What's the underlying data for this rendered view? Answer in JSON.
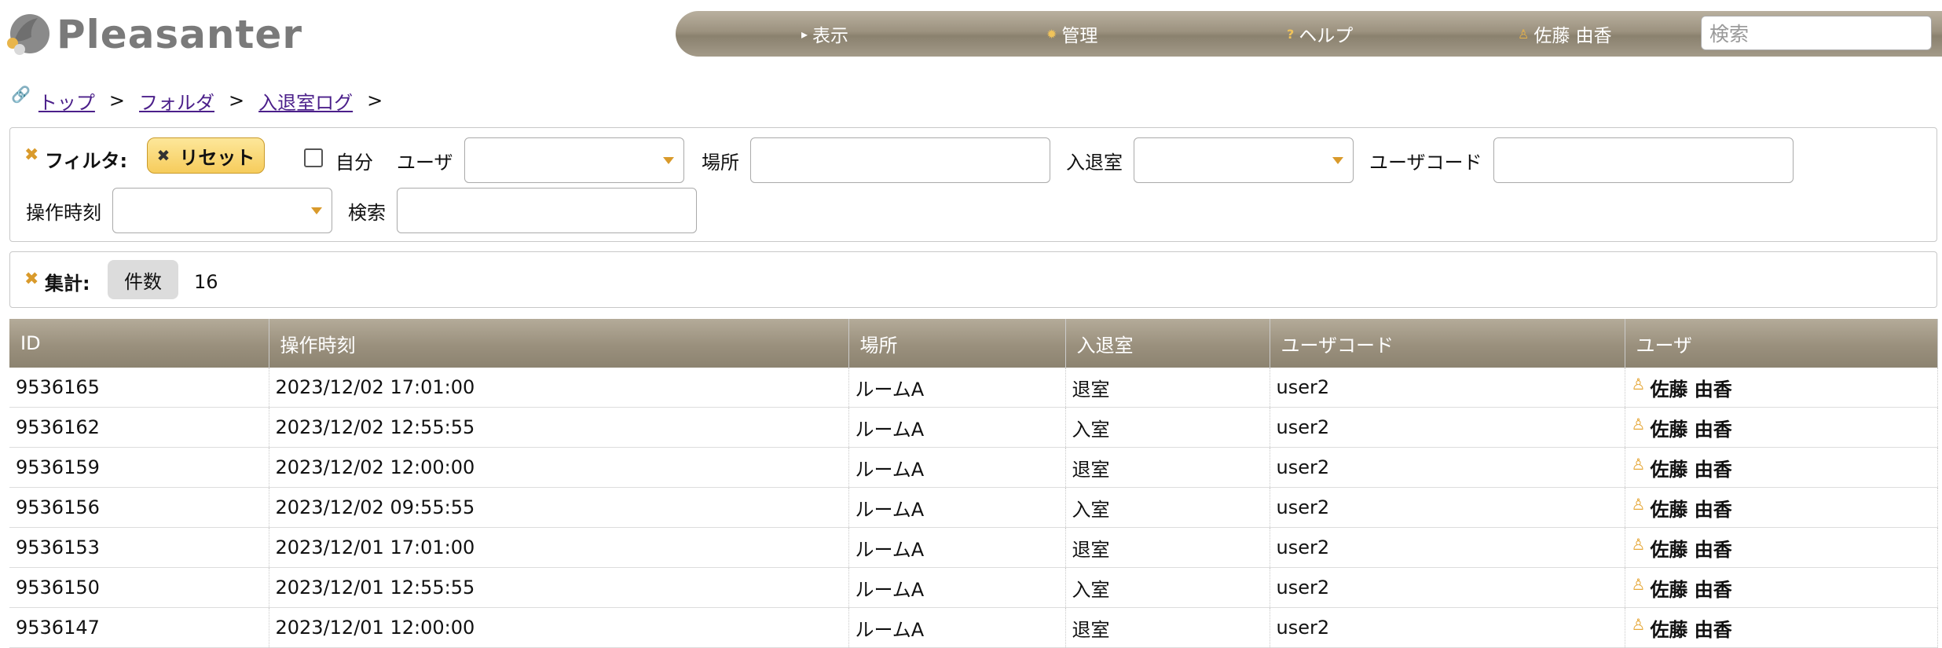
{
  "header": {
    "logo_text": "Pleasanter",
    "nav": [
      {
        "label": "表示",
        "icon": "triangle-right-icon"
      },
      {
        "label": "管理",
        "icon": "gear-icon"
      },
      {
        "label": "ヘルプ",
        "icon": "question-icon"
      },
      {
        "label": "佐藤 由香",
        "icon": "user-icon"
      }
    ],
    "search_placeholder": "検索"
  },
  "breadcrumb": {
    "items": [
      "トップ",
      "フォルダ",
      "入退室ログ"
    ],
    "separator": ">"
  },
  "filter": {
    "title": "フィルタ:",
    "reset_label": "リセット",
    "self_label": "自分",
    "user_label": "ユーザ",
    "place_label": "場所",
    "inout_label": "入退室",
    "usercode_label": "ユーザコード",
    "optime_label": "操作時刻",
    "search_label": "検索"
  },
  "aggregation": {
    "title": "集計:",
    "count_label": "件数",
    "count_value": "16"
  },
  "table": {
    "columns": [
      "ID",
      "操作時刻",
      "場所",
      "入退室",
      "ユーザコード",
      "ユーザ"
    ],
    "rows": [
      [
        "9536165",
        "2023/12/02 17:01:00",
        "ルームA",
        "退室",
        "user2",
        "佐藤 由香"
      ],
      [
        "9536162",
        "2023/12/02 12:55:55",
        "ルームA",
        "入室",
        "user2",
        "佐藤 由香"
      ],
      [
        "9536159",
        "2023/12/02 12:00:00",
        "ルームA",
        "退室",
        "user2",
        "佐藤 由香"
      ],
      [
        "9536156",
        "2023/12/02 09:55:55",
        "ルームA",
        "入室",
        "user2",
        "佐藤 由香"
      ],
      [
        "9536153",
        "2023/12/01 17:01:00",
        "ルームA",
        "退室",
        "user2",
        "佐藤 由香"
      ],
      [
        "9536150",
        "2023/12/01 12:55:55",
        "ルームA",
        "入室",
        "user2",
        "佐藤 由香"
      ],
      [
        "9536147",
        "2023/12/01 12:00:00",
        "ルームA",
        "退室",
        "user2",
        "佐藤 由香"
      ]
    ]
  },
  "colors": {
    "nav_bar": "#9c927f",
    "accent": "#d99a2b",
    "link": "#4b1f8a",
    "reset_button": "#f6cc5c"
  }
}
